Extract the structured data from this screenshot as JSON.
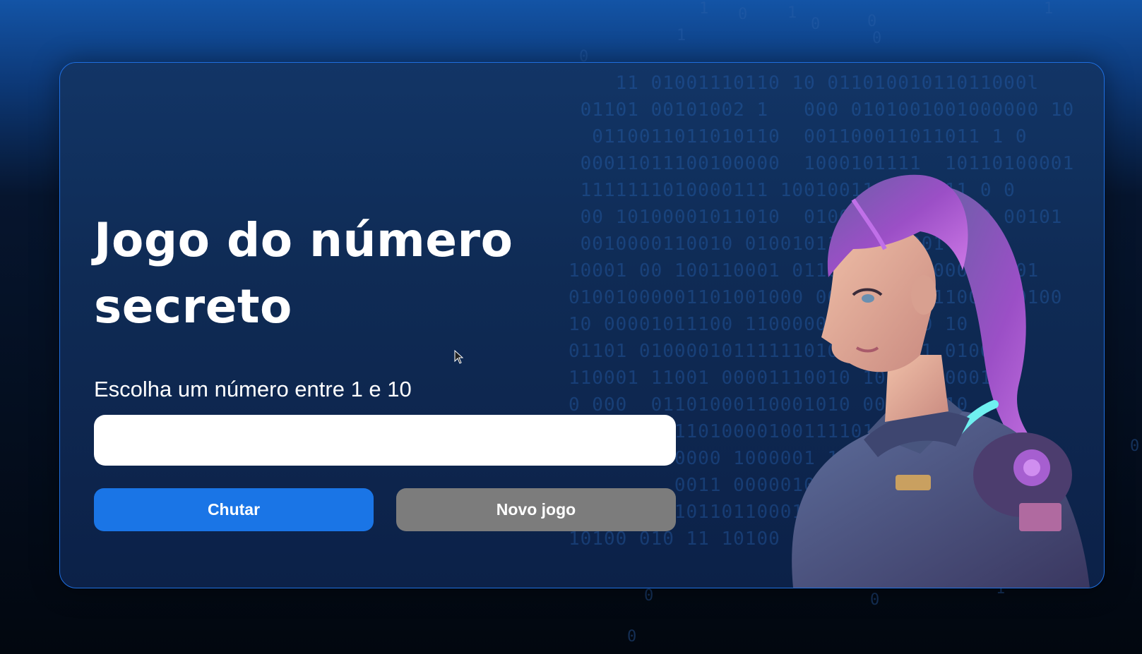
{
  "game": {
    "title": "Jogo do número secreto",
    "instruction": "Escolha um número entre 1 e 10",
    "input_value": "",
    "guess_button": "Chutar",
    "new_game_button": "Novo jogo"
  },
  "theme": {
    "accent": "#1a75e6",
    "secondary": "#7c7c7c",
    "border": "#1f6fe0"
  },
  "icons": {
    "illustration": "astronaut-girl-illustration",
    "cursor": "mouse-pointer-icon"
  }
}
